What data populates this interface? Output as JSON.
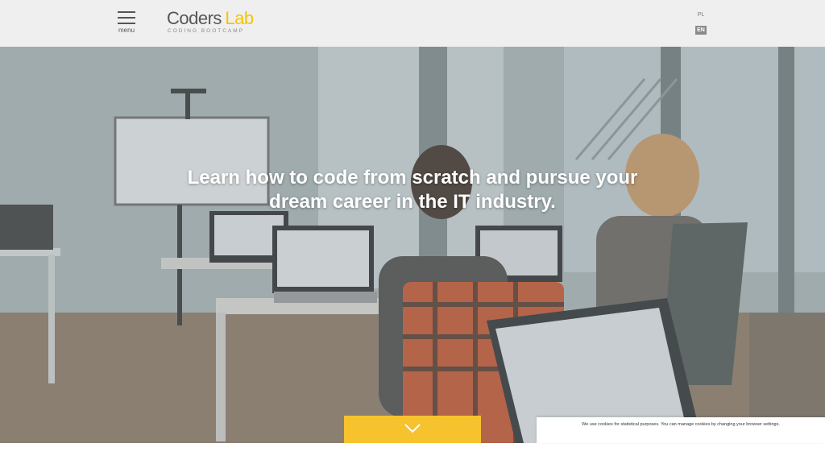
{
  "header": {
    "menu_label": "menu",
    "logo": {
      "word1": "Coders",
      "word2": "Lab",
      "tagline": "CODING   BOOTCAMP"
    },
    "languages": {
      "pl": "PL",
      "en": "EN",
      "active": "EN"
    }
  },
  "hero": {
    "headline_line1": "Learn how to code from scratch and pursue your",
    "headline_line2": "dream career in the IT industry.",
    "scroll_icon": "chevron-down-icon",
    "accent_color": "#f6c22d"
  },
  "cookie_bar": {
    "text": "We use cookies for statistical purposes. You can manage cookies by changing your browser settings."
  }
}
